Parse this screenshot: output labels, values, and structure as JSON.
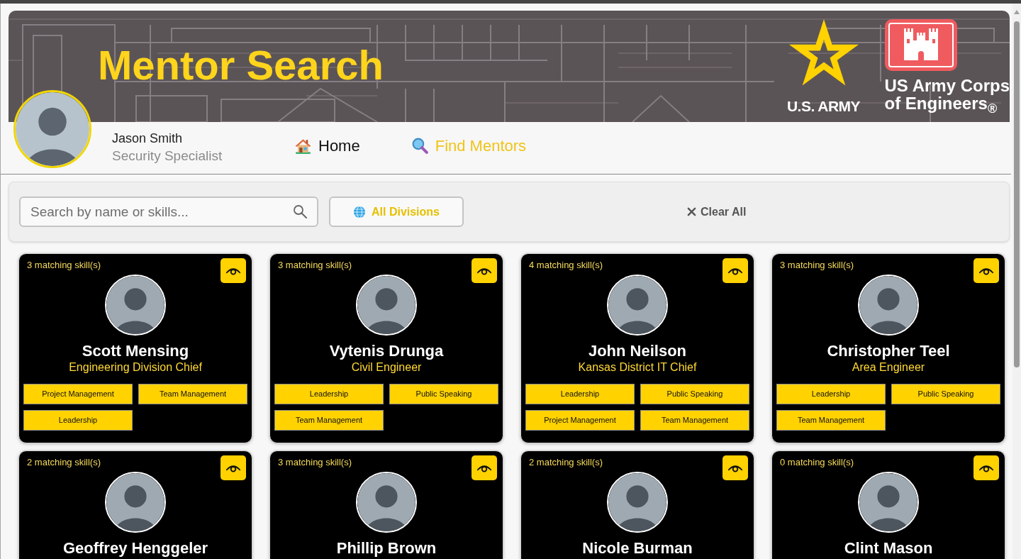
{
  "header": {
    "title": "Mentor Search",
    "army_logo_text": "U.S. ARMY",
    "corps_logo_lines": [
      "US Army Corps",
      "of Engineers$_{®}$"
    ]
  },
  "user": {
    "name": "Jason Smith",
    "role": "Security Specialist"
  },
  "nav": [
    {
      "label": "Home",
      "selected": false
    },
    {
      "label": "Find Mentors",
      "selected": true
    }
  ],
  "filters": {
    "search": {
      "placeholder": "Search by name or skills..."
    },
    "division_button": "All Divisions",
    "clear_button": "Clear All"
  },
  "mentors": [
    {
      "matching": "3 matching skill(s)",
      "name": "Scott Mensing",
      "title": "Engineering Division Chief",
      "skills": [
        "Project Management",
        "Team Management",
        "Leadership"
      ]
    },
    {
      "matching": "3 matching skill(s)",
      "name": "Vytenis Drunga",
      "title": "Civil Engineer",
      "skills": [
        "Leadership",
        "Public Speaking",
        "Team Management"
      ]
    },
    {
      "matching": "4 matching skill(s)",
      "name": "John Neilson",
      "title": "Kansas District IT Chief",
      "skills": [
        "Leadership",
        "Public Speaking",
        "Project Management",
        "Team Management"
      ]
    },
    {
      "matching": "3 matching skill(s)",
      "name": "Christopher Teel",
      "title": "Area Engineer",
      "skills": [
        "Leadership",
        "Public Speaking",
        "Team Management"
      ]
    },
    {
      "matching": "2 matching skill(s)",
      "name": "Geoffrey Henggeler"
    },
    {
      "matching": "3 matching skill(s)",
      "name": "Phillip Brown"
    },
    {
      "matching": "2 matching skill(s)",
      "name": "Nicole Burman"
    },
    {
      "matching": "0 matching skill(s)",
      "name": "Clint Mason"
    }
  ]
}
